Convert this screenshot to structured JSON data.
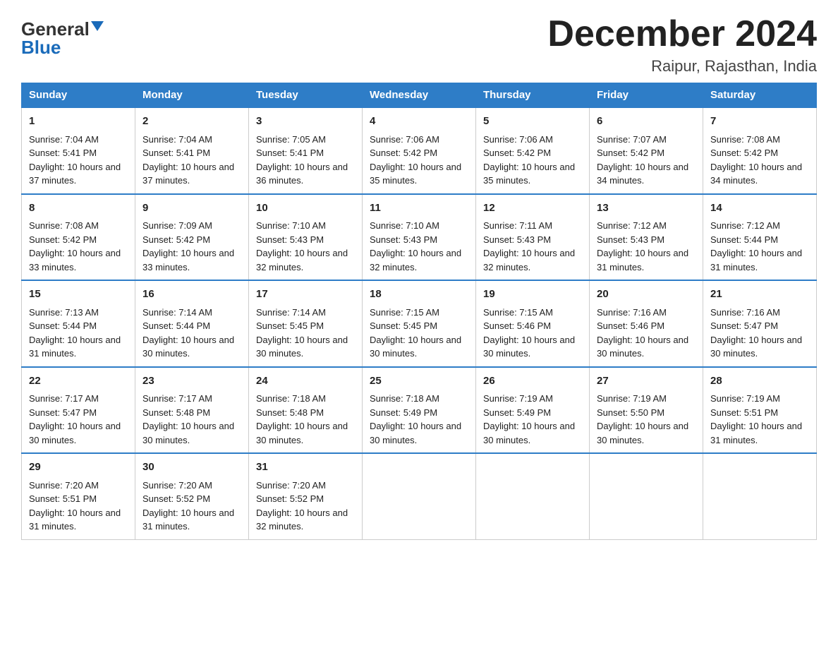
{
  "header": {
    "logo_general": "General",
    "logo_blue": "Blue",
    "title": "December 2024",
    "subtitle": "Raipur, Rajasthan, India"
  },
  "calendar": {
    "days_of_week": [
      "Sunday",
      "Monday",
      "Tuesday",
      "Wednesday",
      "Thursday",
      "Friday",
      "Saturday"
    ],
    "weeks": [
      [
        {
          "day": "1",
          "sunrise": "7:04 AM",
          "sunset": "5:41 PM",
          "daylight": "10 hours and 37 minutes."
        },
        {
          "day": "2",
          "sunrise": "7:04 AM",
          "sunset": "5:41 PM",
          "daylight": "10 hours and 37 minutes."
        },
        {
          "day": "3",
          "sunrise": "7:05 AM",
          "sunset": "5:41 PM",
          "daylight": "10 hours and 36 minutes."
        },
        {
          "day": "4",
          "sunrise": "7:06 AM",
          "sunset": "5:42 PM",
          "daylight": "10 hours and 35 minutes."
        },
        {
          "day": "5",
          "sunrise": "7:06 AM",
          "sunset": "5:42 PM",
          "daylight": "10 hours and 35 minutes."
        },
        {
          "day": "6",
          "sunrise": "7:07 AM",
          "sunset": "5:42 PM",
          "daylight": "10 hours and 34 minutes."
        },
        {
          "day": "7",
          "sunrise": "7:08 AM",
          "sunset": "5:42 PM",
          "daylight": "10 hours and 34 minutes."
        }
      ],
      [
        {
          "day": "8",
          "sunrise": "7:08 AM",
          "sunset": "5:42 PM",
          "daylight": "10 hours and 33 minutes."
        },
        {
          "day": "9",
          "sunrise": "7:09 AM",
          "sunset": "5:42 PM",
          "daylight": "10 hours and 33 minutes."
        },
        {
          "day": "10",
          "sunrise": "7:10 AM",
          "sunset": "5:43 PM",
          "daylight": "10 hours and 32 minutes."
        },
        {
          "day": "11",
          "sunrise": "7:10 AM",
          "sunset": "5:43 PM",
          "daylight": "10 hours and 32 minutes."
        },
        {
          "day": "12",
          "sunrise": "7:11 AM",
          "sunset": "5:43 PM",
          "daylight": "10 hours and 32 minutes."
        },
        {
          "day": "13",
          "sunrise": "7:12 AM",
          "sunset": "5:43 PM",
          "daylight": "10 hours and 31 minutes."
        },
        {
          "day": "14",
          "sunrise": "7:12 AM",
          "sunset": "5:44 PM",
          "daylight": "10 hours and 31 minutes."
        }
      ],
      [
        {
          "day": "15",
          "sunrise": "7:13 AM",
          "sunset": "5:44 PM",
          "daylight": "10 hours and 31 minutes."
        },
        {
          "day": "16",
          "sunrise": "7:14 AM",
          "sunset": "5:44 PM",
          "daylight": "10 hours and 30 minutes."
        },
        {
          "day": "17",
          "sunrise": "7:14 AM",
          "sunset": "5:45 PM",
          "daylight": "10 hours and 30 minutes."
        },
        {
          "day": "18",
          "sunrise": "7:15 AM",
          "sunset": "5:45 PM",
          "daylight": "10 hours and 30 minutes."
        },
        {
          "day": "19",
          "sunrise": "7:15 AM",
          "sunset": "5:46 PM",
          "daylight": "10 hours and 30 minutes."
        },
        {
          "day": "20",
          "sunrise": "7:16 AM",
          "sunset": "5:46 PM",
          "daylight": "10 hours and 30 minutes."
        },
        {
          "day": "21",
          "sunrise": "7:16 AM",
          "sunset": "5:47 PM",
          "daylight": "10 hours and 30 minutes."
        }
      ],
      [
        {
          "day": "22",
          "sunrise": "7:17 AM",
          "sunset": "5:47 PM",
          "daylight": "10 hours and 30 minutes."
        },
        {
          "day": "23",
          "sunrise": "7:17 AM",
          "sunset": "5:48 PM",
          "daylight": "10 hours and 30 minutes."
        },
        {
          "day": "24",
          "sunrise": "7:18 AM",
          "sunset": "5:48 PM",
          "daylight": "10 hours and 30 minutes."
        },
        {
          "day": "25",
          "sunrise": "7:18 AM",
          "sunset": "5:49 PM",
          "daylight": "10 hours and 30 minutes."
        },
        {
          "day": "26",
          "sunrise": "7:19 AM",
          "sunset": "5:49 PM",
          "daylight": "10 hours and 30 minutes."
        },
        {
          "day": "27",
          "sunrise": "7:19 AM",
          "sunset": "5:50 PM",
          "daylight": "10 hours and 30 minutes."
        },
        {
          "day": "28",
          "sunrise": "7:19 AM",
          "sunset": "5:51 PM",
          "daylight": "10 hours and 31 minutes."
        }
      ],
      [
        {
          "day": "29",
          "sunrise": "7:20 AM",
          "sunset": "5:51 PM",
          "daylight": "10 hours and 31 minutes."
        },
        {
          "day": "30",
          "sunrise": "7:20 AM",
          "sunset": "5:52 PM",
          "daylight": "10 hours and 31 minutes."
        },
        {
          "day": "31",
          "sunrise": "7:20 AM",
          "sunset": "5:52 PM",
          "daylight": "10 hours and 32 minutes."
        },
        null,
        null,
        null,
        null
      ]
    ]
  },
  "labels": {
    "sunrise_prefix": "Sunrise: ",
    "sunset_prefix": "Sunset: ",
    "daylight_prefix": "Daylight: "
  }
}
